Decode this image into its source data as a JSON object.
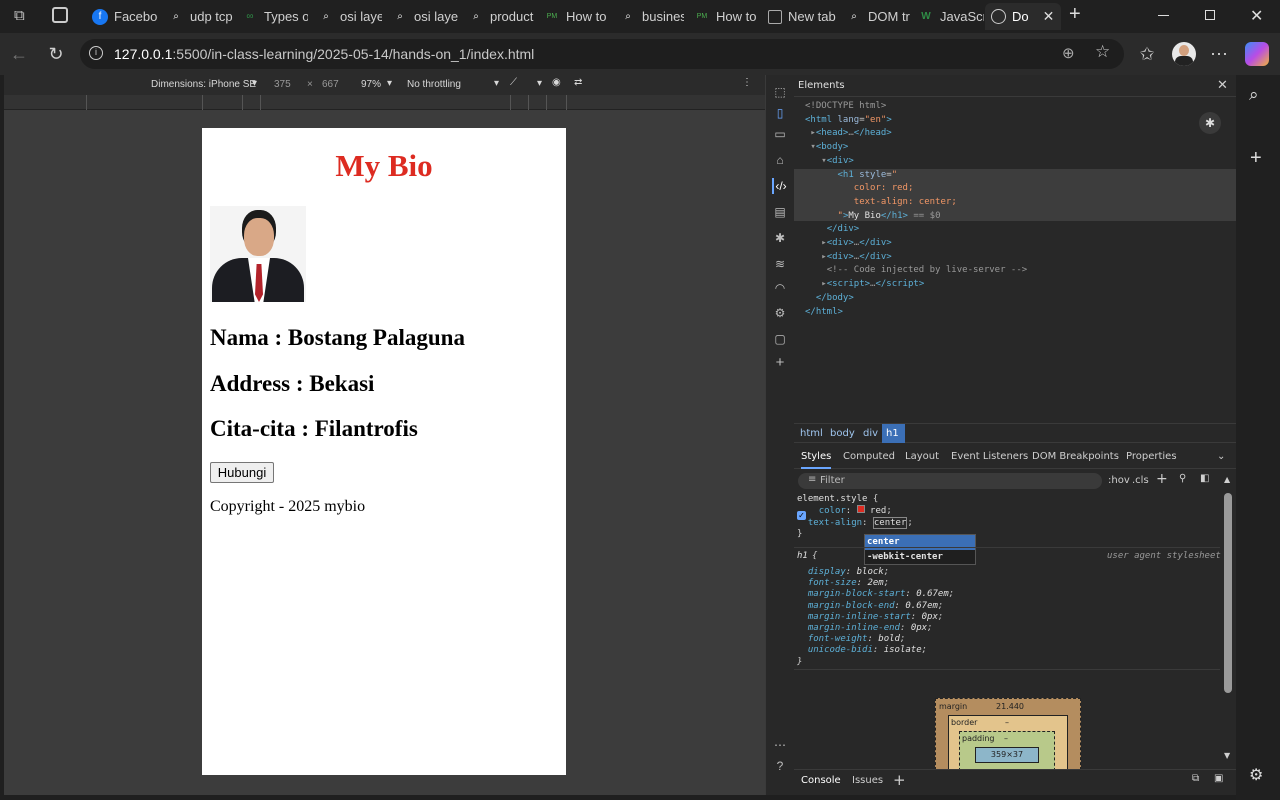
{
  "browser": {
    "tabs": [
      {
        "label": "Facebook",
        "icon": "facebook-icon",
        "color": "#1877f2"
      },
      {
        "label": "udp tcp",
        "icon": "search-icon"
      },
      {
        "label": "Types of",
        "icon": "gfg-icon"
      },
      {
        "label": "osi layer",
        "icon": "search-icon"
      },
      {
        "label": "osi layer",
        "icon": "search-icon"
      },
      {
        "label": "product",
        "icon": "search-icon"
      },
      {
        "label": "How to",
        "icon": "pm-icon"
      },
      {
        "label": "business",
        "icon": "search-icon"
      },
      {
        "label": "How to",
        "icon": "pm-icon"
      },
      {
        "label": "New tab",
        "icon": "newtab-icon"
      },
      {
        "label": "DOM tr",
        "icon": "search-icon"
      },
      {
        "label": "JavaScri",
        "icon": "w-icon"
      },
      {
        "label": "Do",
        "icon": "globe-icon"
      }
    ],
    "url_host": "127.0.0.1",
    "url_rest": ":5500/in-class-learning/2025-05-14/hands-on_1/index.html"
  },
  "device_toolbar": {
    "dimensions_label": "Dimensions: iPhone SE",
    "width": "375",
    "times": "×",
    "height": "667",
    "zoom": "97%",
    "throttling": "No throttling"
  },
  "page": {
    "heading": "My Bio",
    "nama": "Nama : Bostang Palaguna",
    "address": "Address : Bekasi",
    "cita": "Cita-cita : Filantrofis",
    "button": "Hubungi",
    "copyright": "Copyright - 2025 mybio"
  },
  "devtools": {
    "panel_title": "Elements",
    "breadcrumbs": [
      "html",
      "body",
      "div",
      "h1"
    ],
    "style_tabs": [
      "Styles",
      "Computed",
      "Layout",
      "Event Listeners",
      "DOM Breakpoints",
      "Properties"
    ],
    "filter_placeholder": "Filter",
    "hov": ":hov",
    "cls": ".cls",
    "element_style": "element.style",
    "ua_selector": "h1",
    "ua_label": "user agent stylesheet",
    "autocomplete": [
      "center",
      "-webkit-center"
    ],
    "boxmodel": {
      "margin_label": "margin",
      "margin_value": "21.440",
      "border_label": "border",
      "border_value": "–",
      "padding_label": "padding",
      "padding_value": "–",
      "content": "359×37"
    },
    "drawer_tabs": [
      "Console",
      "Issues"
    ]
  },
  "colors": {
    "heading": "#dd2b21",
    "accent": "#3b6fb6"
  }
}
